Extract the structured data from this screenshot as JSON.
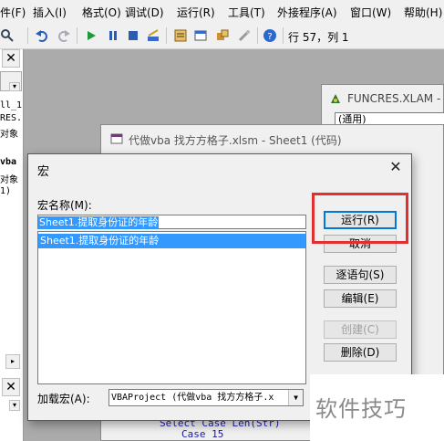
{
  "menubar": {
    "items": [
      "件(F)",
      "插入(I)",
      "格式(O)",
      "调试(D)",
      "运行(R)",
      "工具(T)",
      "外接程序(A)",
      "窗口(W)",
      "帮助(H)"
    ]
  },
  "toolbar": {
    "position_readout": "行 57，列 1"
  },
  "left_pane": {
    "lines": [
      "ll_1",
      "RES.",
      "对象",
      "vba",
      "对象",
      "1)"
    ]
  },
  "funcres_window": {
    "title": "FUNCRES.XLAM -",
    "combo_value": "(通用)"
  },
  "sheet1_window": {
    "title": "代做vba 找方方格子.xlsm - Sheet1 (代码)",
    "code_lines": [
      "Select Case Len(Str)",
      "Case 15"
    ]
  },
  "dialog": {
    "title": "宏",
    "close_glyph": "✕",
    "macro_name_label": "宏名称(M):",
    "macro_name_value": "Sheet1.提取身份证的年龄",
    "macro_list": [
      "Sheet1.提取身份证的年龄"
    ],
    "buttons": {
      "run": "运行(R)",
      "cancel": "取消",
      "step_into": "逐语句(S)",
      "edit": "编辑(E)",
      "create": "创建(C)",
      "delete": "删除(D)"
    },
    "load_label": "加载宏(A):",
    "project_value": "VBAProject (代做vba 找方方格子.x"
  },
  "watermark": {
    "text": "软件技巧"
  },
  "colors": {
    "selection": "#3399ff",
    "highlight_box": "#e03030",
    "link_blue": "#0078d7"
  }
}
